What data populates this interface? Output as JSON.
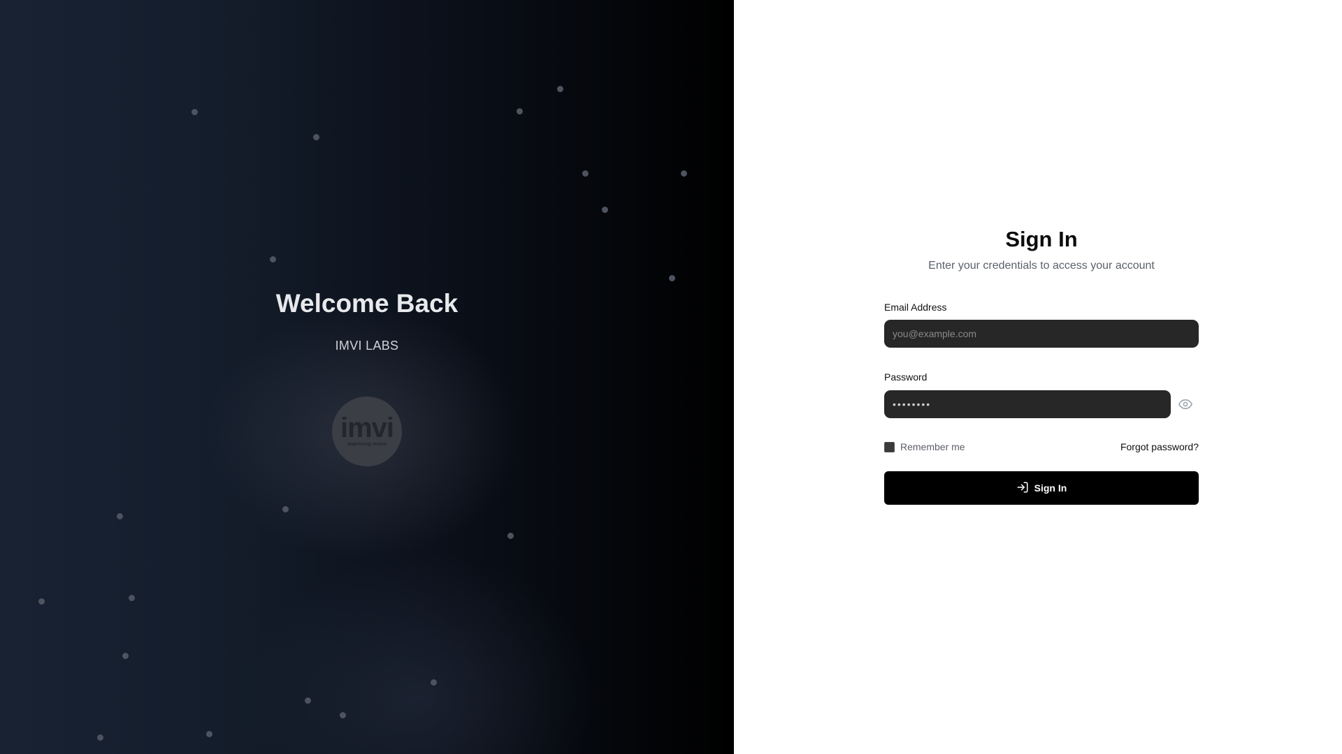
{
  "hero": {
    "title": "Welcome Back",
    "subtitle": "IMVI LABS",
    "logo": {
      "wordmark": "imvi",
      "tagline": "improving vision"
    }
  },
  "signin": {
    "title": "Sign In",
    "subtitle": "Enter your credentials to access your account",
    "email": {
      "label": "Email Address",
      "placeholder": "you@example.com",
      "value": ""
    },
    "password": {
      "label": "Password",
      "value": "••••••••",
      "toggle_icon": "eye-icon"
    },
    "remember_label": "Remember me",
    "remember_checked": false,
    "forgot_label": "Forgot password?",
    "submit_label": "Sign In",
    "submit_icon": "log-in-icon"
  },
  "colors": {
    "panel_dark": "#182233",
    "input_bg": "#272727",
    "button_bg": "#000000"
  }
}
